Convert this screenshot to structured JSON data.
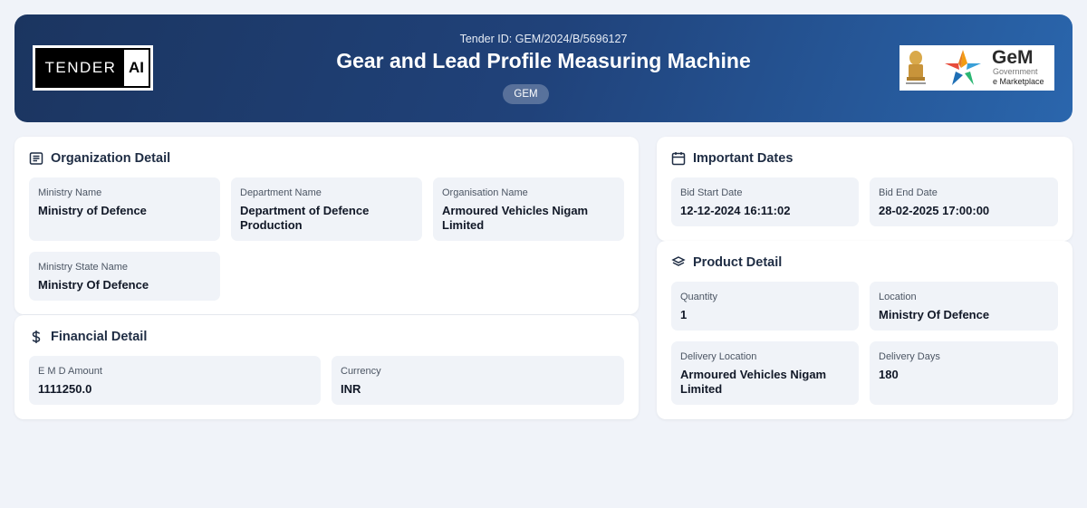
{
  "header": {
    "tender_id": "Tender ID: GEM/2024/B/5696127",
    "title": "Gear and Lead Profile Measuring Machine",
    "badge": "GEM",
    "logo_left": {
      "part1": "TENDER",
      "part2": "AI"
    },
    "logo_right": {
      "name": "GeM",
      "line1": "Government",
      "line2": "e Marketplace"
    }
  },
  "organization": {
    "title": "Organization Detail",
    "icon": "document-list-icon",
    "fields": [
      {
        "label": "Ministry Name",
        "value": "Ministry of Defence"
      },
      {
        "label": "Department Name",
        "value": "Department of Defence Production"
      },
      {
        "label": "Organisation Name",
        "value": "Armoured Vehicles Nigam Limited"
      },
      {
        "label": "Ministry State Name",
        "value": "Ministry Of Defence"
      }
    ]
  },
  "financial": {
    "title": "Financial Detail",
    "icon": "dollar-icon",
    "fields": [
      {
        "label": "E M D Amount",
        "value": "1111250.0"
      },
      {
        "label": "Currency",
        "value": "INR"
      }
    ]
  },
  "dates": {
    "title": "Important Dates",
    "icon": "calendar-icon",
    "fields": [
      {
        "label": "Bid Start Date",
        "value": "12-12-2024 16:11:02"
      },
      {
        "label": "Bid End Date",
        "value": "28-02-2025 17:00:00"
      }
    ]
  },
  "product": {
    "title": "Product Detail",
    "icon": "layers-icon",
    "fields": [
      {
        "label": "Quantity",
        "value": "1"
      },
      {
        "label": "Location",
        "value": "Ministry Of Defence"
      },
      {
        "label": "Delivery Location",
        "value": "Armoured Vehicles Nigam Limited"
      },
      {
        "label": "Delivery Days",
        "value": "180"
      }
    ]
  },
  "colors": {
    "header_start": "#1b3560",
    "header_end": "#2a66ad",
    "page_bg": "#f0f3f9",
    "field_bg": "#f0f3f8"
  }
}
